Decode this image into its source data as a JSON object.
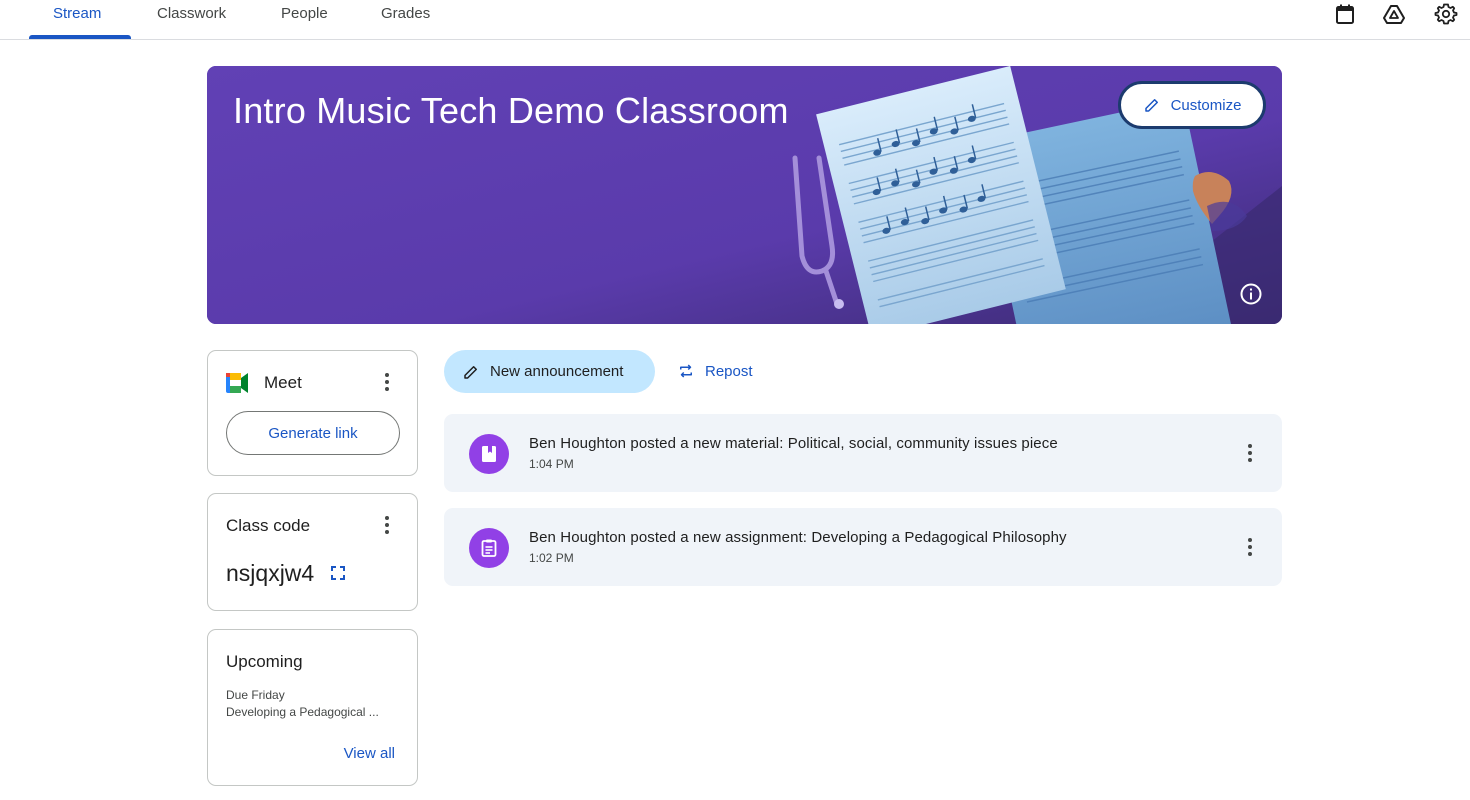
{
  "tabs": [
    {
      "label": "Stream",
      "active": true
    },
    {
      "label": "Classwork",
      "active": false
    },
    {
      "label": "People",
      "active": false
    },
    {
      "label": "Grades",
      "active": false
    }
  ],
  "top_icons": [
    "calendar-icon",
    "drive-icon",
    "settings-icon"
  ],
  "banner": {
    "title": "Intro Music Tech Demo Classroom",
    "customize_label": "Customize",
    "background_color": "#5e3fb0"
  },
  "meet": {
    "title": "Meet",
    "generate_label": "Generate link"
  },
  "class_code": {
    "title": "Class code",
    "code": "nsjqxjw4"
  },
  "upcoming": {
    "title": "Upcoming",
    "due": "Due Friday",
    "item": "Developing a Pedagogical ...",
    "view_all": "View all"
  },
  "actions": {
    "new_announcement": "New announcement",
    "repost": "Repost"
  },
  "posts": [
    {
      "text": "Ben Houghton posted a new material: Political, social, community issues piece",
      "time": "1:04 PM",
      "icon": "material-icon"
    },
    {
      "text": "Ben Houghton posted a new assignment: Developing a Pedagogical Philosophy",
      "time": "1:02 PM",
      "icon": "assignment-icon"
    }
  ],
  "colors": {
    "accent": "#1a56c4",
    "post_bg": "#f0f4f9",
    "avatar": "#9140e6",
    "announcement_bg": "#c2e7ff"
  }
}
